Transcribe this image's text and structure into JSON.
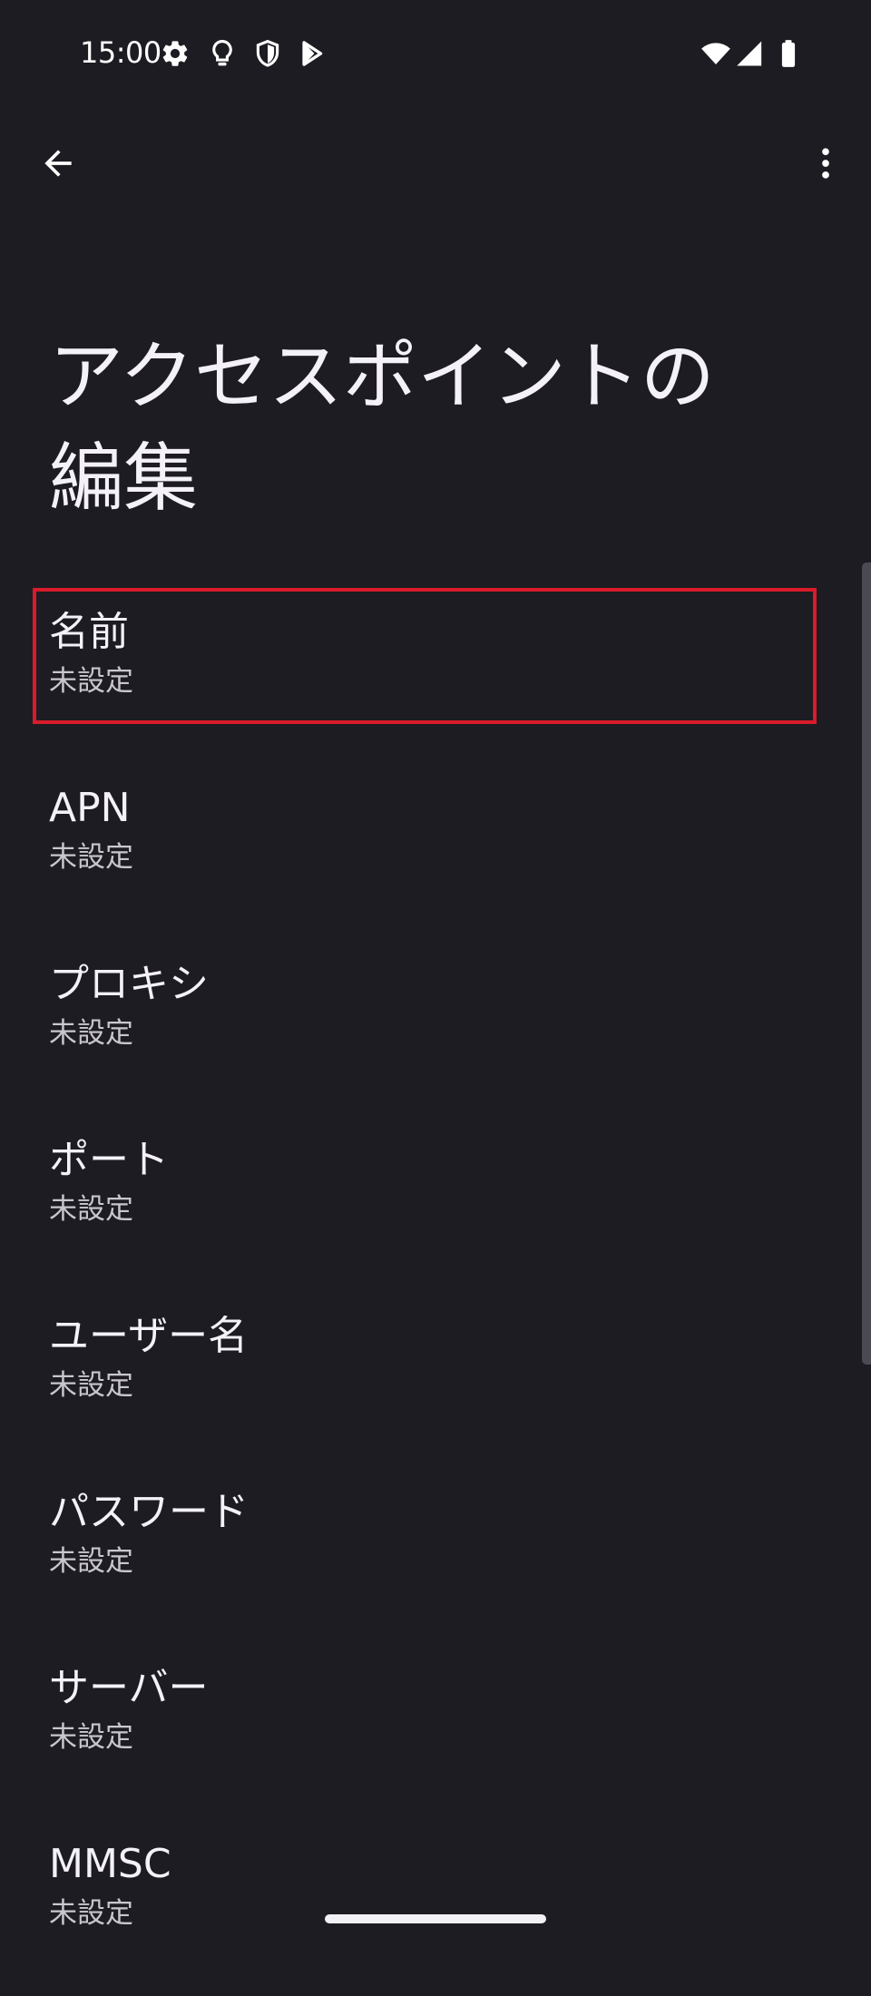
{
  "status_bar": {
    "time": "15:00",
    "left_icons": [
      "gear-icon",
      "lightbulb-icon",
      "shield-icon",
      "play-store-icon"
    ],
    "right_icons": [
      "wifi-icon",
      "cell-signal-icon",
      "battery-icon"
    ]
  },
  "app_bar": {
    "back_icon": "back-arrow-icon",
    "more_icon": "more-vert-icon"
  },
  "page": {
    "title_line1": "アクセスポイントの",
    "title_line2": "編集"
  },
  "settings": {
    "items": [
      {
        "title": "名前",
        "summary": "未設定",
        "highlighted": true
      },
      {
        "title": "APN",
        "summary": "未設定"
      },
      {
        "title": "プロキシ",
        "summary": "未設定"
      },
      {
        "title": "ポート",
        "summary": "未設定"
      },
      {
        "title": "ユーザー名",
        "summary": "未設定"
      },
      {
        "title": "パスワード",
        "summary": "未設定"
      },
      {
        "title": "サーバー",
        "summary": "未設定"
      },
      {
        "title": "MMSC",
        "summary": "未設定"
      }
    ]
  },
  "colors": {
    "background": "#1d1c22",
    "text_primary": "#f4f1f8",
    "text_secondary": "#cac6d0",
    "highlight_border": "#d91b2b"
  }
}
